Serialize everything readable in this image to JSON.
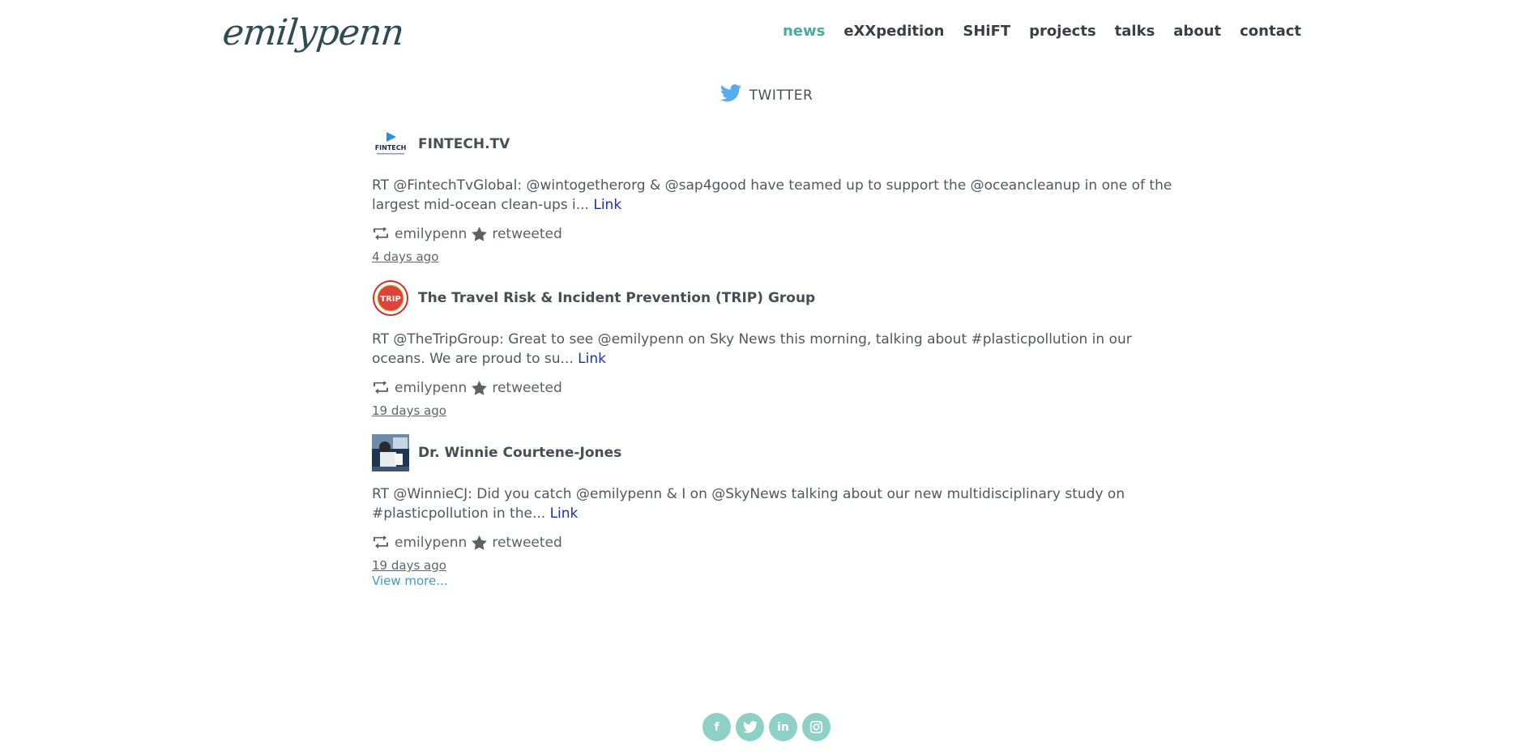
{
  "header": {
    "logo_text": "emilypenn",
    "nav": [
      {
        "label": "news",
        "active": true
      },
      {
        "label": "eXXpedition",
        "active": false
      },
      {
        "label": "SHiFT",
        "active": false
      },
      {
        "label": "projects",
        "active": false
      },
      {
        "label": "talks",
        "active": false
      },
      {
        "label": "about",
        "active": false
      },
      {
        "label": "contact",
        "active": false
      }
    ]
  },
  "feed": {
    "title": "TWITTER",
    "tweets": [
      {
        "author": "FINTECH.TV",
        "avatar_text": "FINTECH",
        "text": "RT @FintechTvGlobal: @wintogetherorg & @sap4good have teamed up to support the @oceancleanup in one of the largest mid-ocean clean-ups i...",
        "link_label": "Link",
        "retweeter": "emilypenn",
        "action": "retweeted",
        "time": "4 days ago"
      },
      {
        "author": "The Travel Risk & Incident Prevention (TRIP) Group",
        "avatar_text": "TRIP",
        "text": "RT @TheTripGroup: Great to see @emilypenn on Sky News this morning, talking about #plasticpollution in our oceans. We are proud to su...",
        "link_label": "Link",
        "retweeter": "emilypenn",
        "action": "retweeted",
        "time": "19 days ago"
      },
      {
        "author": "Dr. Winnie Courtene-Jones",
        "avatar_text": "",
        "text": "RT @WinnieCJ: Did you catch @emilypenn & I on @SkyNews talking about our new multidisciplinary study on #plasticpollution in the...",
        "link_label": "Link",
        "retweeter": "emilypenn",
        "action": "retweeted",
        "time": "19 days ago"
      }
    ],
    "view_more": "View more..."
  },
  "social": [
    {
      "name": "facebook-icon",
      "glyph": "f"
    },
    {
      "name": "twitter-icon",
      "glyph": ""
    },
    {
      "name": "linkedin-icon",
      "glyph": "in"
    },
    {
      "name": "instagram-icon",
      "glyph": ""
    }
  ],
  "colors": {
    "accent": "#4aab9d",
    "link": "#1a30b8",
    "view_more": "#3a9bd8",
    "social_bg": "#8cd0c6",
    "twitter_blue": "#55acee"
  }
}
